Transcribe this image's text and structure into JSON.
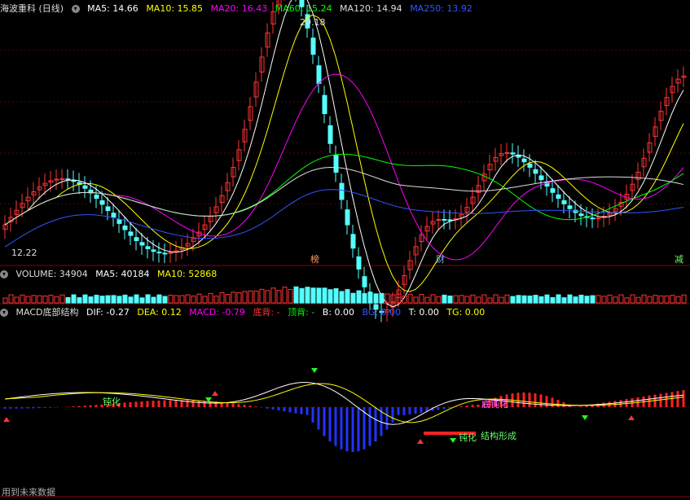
{
  "main": {
    "title": "海波重科 (日线)",
    "ma": [
      {
        "label": "MA5: 14.66",
        "color": "#ffffff"
      },
      {
        "label": "MA10: 15.85",
        "color": "#ffff00"
      },
      {
        "label": "MA20: 16.43",
        "color": "#ff00ff"
      },
      {
        "label": "MA60: 15.24",
        "color": "#00ff00"
      },
      {
        "label": "MA120: 14.94",
        "color": "#dddddd"
      },
      {
        "label": "MA250: 13.92",
        "color": "#3355ff"
      }
    ],
    "high_label": "20.18",
    "low_label": "12.22",
    "event_tags": [
      {
        "text": "榜",
        "color": "#ff9966"
      },
      {
        "text": "财",
        "color": "#66aaff"
      },
      {
        "text": "减",
        "color": "#66ff66"
      }
    ]
  },
  "volume": {
    "title": "VOLUME: 34904",
    "ma5": "MA5: 40184",
    "ma10": "MA10: 52868"
  },
  "macd": {
    "title": "MACD底部结构",
    "items": [
      {
        "label": "DIF: -0.27",
        "color": "#ffffff"
      },
      {
        "label": "DEA: 0.12",
        "color": "#ffff00"
      },
      {
        "label": "MACD: -0.79",
        "color": "#ff00ff"
      },
      {
        "label": "底背: -",
        "color": "#ff3333"
      },
      {
        "label": "顶背: -",
        "color": "#00ff00"
      },
      {
        "label": "B: 0.00",
        "color": "#ffffff"
      },
      {
        "label": "BG: 0.00",
        "color": "#3355ff"
      },
      {
        "label": "T: 0.00",
        "color": "#ffffff"
      },
      {
        "label": "TG: 0.00",
        "color": "#ffff00"
      }
    ],
    "annotations": [
      {
        "text": "钝化",
        "color": "#66ff66"
      },
      {
        "text": "底钝化",
        "color": "#ff66ff"
      },
      {
        "text": "钝化",
        "color": "#66ff66"
      },
      {
        "text": "结构形成",
        "color": "#66ff66"
      }
    ]
  },
  "footer": "用到未来数据"
}
